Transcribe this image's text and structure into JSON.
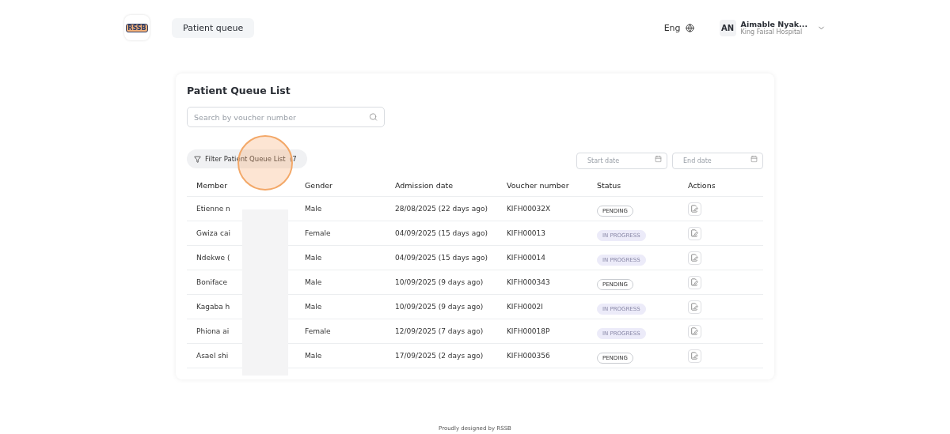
{
  "header": {
    "logo": "RSSB",
    "nav": [
      {
        "label": "Patient queue",
        "selected": true
      }
    ],
    "language": "Eng",
    "user": {
      "initials": "AN",
      "name": "Aimable Nyak...",
      "organization": "King Faisal Hospital"
    }
  },
  "card": {
    "title": "Patient Queue List",
    "search": {
      "placeholder": "Search by voucher number"
    },
    "filter_button": "Filter Patient Queue List  (7",
    "start_date": {
      "placeholder": "Start date"
    },
    "end_date": {
      "placeholder": "End date"
    },
    "table": {
      "columns": [
        "Member",
        "Gender",
        "Admission date",
        "Voucher number",
        "Status",
        "Actions"
      ],
      "rows": [
        {
          "member": "Etienne n",
          "gender": "Male",
          "admission_date": "28/08/2025 (22 days ago)",
          "voucher": "KIFH00032X",
          "status": {
            "label": "PENDING",
            "kind": "pending"
          }
        },
        {
          "member": "Gwiza cai",
          "gender": "Female",
          "admission_date": "04/09/2025 (15 days ago)",
          "voucher": "KIFH00013",
          "status": {
            "label": "IN PROGRESS",
            "kind": "progress"
          }
        },
        {
          "member": "Ndekwe (",
          "gender": "Male",
          "admission_date": "04/09/2025 (15 days ago)",
          "voucher": "KIFH00014",
          "status": {
            "label": "IN PROGRESS",
            "kind": "progress"
          }
        },
        {
          "member": "Boniface",
          "gender": "Male",
          "admission_date": "10/09/2025 (9 days ago)",
          "voucher": "KIFH000343",
          "status": {
            "label": "PENDING",
            "kind": "pending"
          }
        },
        {
          "member": "Kagaba h",
          "gender": "Male",
          "admission_date": "10/09/2025 (9 days ago)",
          "voucher": "KIFH0002I",
          "status": {
            "label": "IN PROGRESS",
            "kind": "progress"
          }
        },
        {
          "member": "Phiona ai",
          "gender": "Female",
          "admission_date": "12/09/2025 (7 days ago)",
          "voucher": "KIFH00018P",
          "status": {
            "label": "IN PROGRESS",
            "kind": "progress"
          }
        },
        {
          "member": "Asael shi",
          "gender": "Male",
          "admission_date": "17/09/2025 (2 days ago)",
          "voucher": "KIFH000356",
          "status": {
            "label": "PENDING",
            "kind": "pending"
          }
        }
      ]
    }
  },
  "footer": "Proudly designed by RSSB"
}
